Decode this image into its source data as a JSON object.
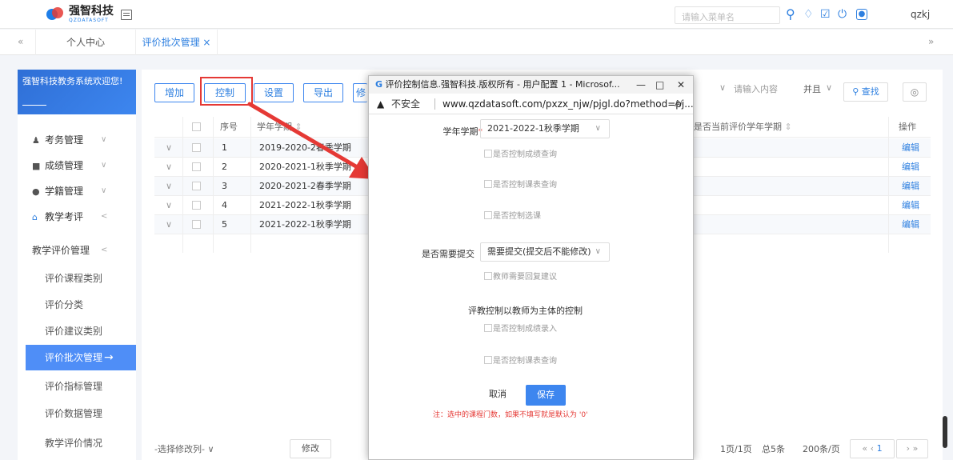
{
  "topbar": {
    "logo_cn": "强智科技",
    "logo_en": "QZDATASOFT",
    "search_placeholder": "请输入菜单名",
    "username": "qzkj"
  },
  "tabs": {
    "nav_left": "«",
    "nav_right": "»",
    "items": [
      {
        "label": "个人中心"
      },
      {
        "label": "评价批次管理 ×"
      }
    ]
  },
  "sidebar": {
    "welcome": "强智科技教务系统欢迎您!",
    "groups": [
      {
        "label": "考务管理",
        "chev": "∨"
      },
      {
        "label": "成绩管理",
        "chev": "∨"
      },
      {
        "label": "学籍管理",
        "chev": "∨"
      },
      {
        "label": "教学考评",
        "chev": "<"
      }
    ],
    "sub_group": {
      "label": "教学评价管理",
      "chev": "<"
    },
    "sub_items": [
      {
        "label": "评价课程类别"
      },
      {
        "label": "评价分类"
      },
      {
        "label": "评价建议类别"
      },
      {
        "label": "评价批次管理",
        "arrow": "→"
      },
      {
        "label": "评价指标管理"
      },
      {
        "label": "评价数据管理"
      },
      {
        "label": "教学评价情况"
      }
    ]
  },
  "toolbar": {
    "add": "增加",
    "control": "控制",
    "settings": "设置",
    "export": "导出",
    "partial": "修",
    "search_placeholder": "请输入内容",
    "logic": "并且",
    "find": "查找"
  },
  "table": {
    "headers": {
      "index": "序号",
      "term": "学年学期",
      "current": "是否当前评价学年学期",
      "ops": "操作"
    },
    "rows": [
      {
        "index": "1",
        "term": "2019-2020-2春季学期",
        "op": "编辑"
      },
      {
        "index": "2",
        "term": "2020-2021-1秋季学期",
        "op": "编辑"
      },
      {
        "index": "3",
        "term": "2020-2021-2春季学期",
        "op": "编辑"
      },
      {
        "index": "4",
        "term": "2021-2022-1秋季学期",
        "op": "编辑"
      },
      {
        "index": "5",
        "term": "2021-2022-1秋季学期",
        "op": "编辑"
      }
    ]
  },
  "bottom": {
    "select_label": "-选择修改列-",
    "modify": "修改",
    "page_info": "1页/1页",
    "total": "总5条",
    "per_page": "200条/页",
    "current_page": "1"
  },
  "modal": {
    "window_title": "评价控制信息.强智科技.版权所有 - 用户配置 1 - Microsof...",
    "insecure": "不安全",
    "url": "www.qzdatasoft.com/pxzx_njw/pjgl.do?method=pj...",
    "term_label": "学年学期",
    "term_value": "2021-2022-1秋季学期",
    "cb1": "是否控制成绩查询",
    "cb2": "是否控制课表查询",
    "cb3": "是否控制选课",
    "submit_label": "是否需要提交",
    "submit_value": "需要提交(提交后不能修改)",
    "cb4": "教师需要回复建议",
    "section": "评教控制以教师为主体的控制",
    "cb5": "是否控制成绩录入",
    "cb6": "是否控制课表查询",
    "cancel": "取消",
    "save": "保存",
    "note": "注：选中的课程门数，如果不填写就是默认为 '0'"
  }
}
